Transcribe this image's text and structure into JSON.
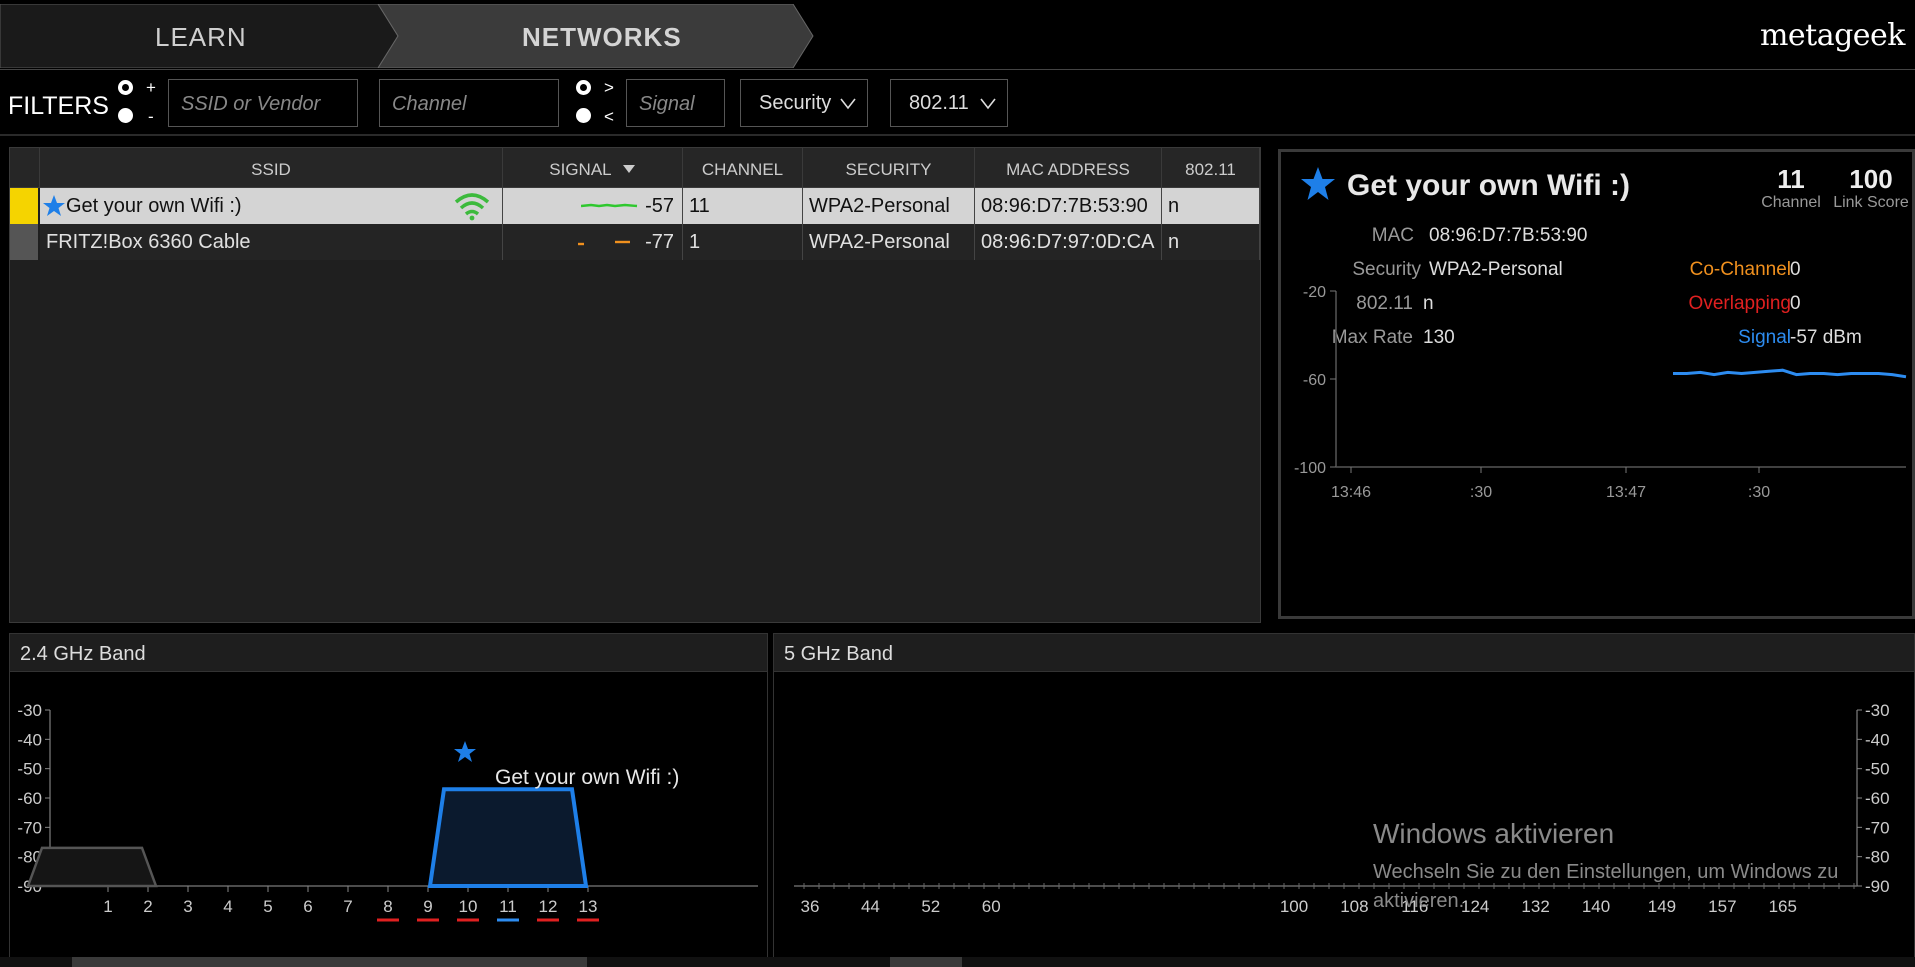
{
  "nav": {
    "learn": "LEARN",
    "networks": "NETWORKS",
    "brand": "metageek"
  },
  "filters": {
    "label": "FILTERS",
    "plus": "+",
    "minus": "-",
    "ssid_placeholder": "SSID or Vendor",
    "channel_placeholder": "Channel",
    "gt": ">",
    "lt": "<",
    "signal_placeholder": "Signal",
    "security": "Security",
    "standard": "802.11"
  },
  "table": {
    "columns": [
      "SSID",
      "SIGNAL",
      "CHANNEL",
      "SECURITY",
      "MAC ADDRESS",
      "802.11"
    ],
    "rows": [
      {
        "ssid": "Get your own Wifi :)",
        "signal": "-57",
        "channel": "11",
        "security": "WPA2-Personal",
        "mac": "08:96:D7:7B:53:90",
        "std": "n",
        "color": "#f5d400",
        "starred": true
      },
      {
        "ssid": "FRITZ!Box 6360 Cable",
        "signal": "-77",
        "channel": "1",
        "security": "WPA2-Personal",
        "mac": "08:96:D7:97:0D:CA",
        "std": "n",
        "color": "#555555",
        "starred": false
      }
    ]
  },
  "detail": {
    "title": "Get your own Wifi :)",
    "channel_value": "11",
    "channel_caption": "Channel",
    "score_value": "100",
    "score_caption": "Link Score",
    "mac_key": "MAC",
    "mac_val": "08:96:D7:7B:53:90",
    "security_key": "Security",
    "security_val": "WPA2-Personal",
    "std_key": "802.11",
    "std_val": "n",
    "rate_key": "Max Rate",
    "rate_val": "130",
    "cochannel_key": "Co-Channel",
    "cochannel_val": "0",
    "overlap_key": "Overlapping",
    "overlap_val": "0",
    "signal_key": "Signal",
    "signal_val": "-57 dBm",
    "colors": {
      "cochannel": "#f0901e",
      "overlap": "#e02020",
      "signal": "#2d8cf0"
    }
  },
  "bands": {
    "band24_title": "2.4 GHz Band",
    "band5_title": "5 GHz Band",
    "network_label": "Get your own Wifi :)"
  },
  "watermark": {
    "title": "Windows aktivieren",
    "sub": "Wechseln Sie zu den Einstellungen, um Windows zu aktivieren."
  },
  "chart_data": [
    {
      "type": "line",
      "title": "",
      "ylabel": "",
      "xlabel": "",
      "y_ticks": [
        "-20",
        "-60",
        "-100"
      ],
      "x_ticks": [
        "13:46",
        ":30",
        "13:47",
        ":30"
      ],
      "ylim": [
        -100,
        -20
      ],
      "series": [
        {
          "values": [
            -57.5,
            -57.5,
            -57,
            -58,
            -57,
            -57.5,
            -57,
            -56.5,
            -56,
            -58,
            -57.5,
            -57.5,
            -58,
            -57.5,
            -57.5,
            -57.5,
            -58,
            -59
          ]
        }
      ]
    },
    {
      "type": "area",
      "title": "2.4 GHz Band",
      "y_ticks": [
        "-30",
        "-40",
        "-50",
        "-60",
        "-70",
        "-80",
        "-90"
      ],
      "x_ticks": [
        "1",
        "2",
        "3",
        "4",
        "5",
        "6",
        "7",
        "8",
        "9",
        "10",
        "11",
        "12",
        "13"
      ],
      "ylim": [
        -90,
        -30
      ],
      "series": [
        {
          "name": "Get your own Wifi :)",
          "channel": 11,
          "value": -57
        },
        {
          "channel": 1,
          "value": -77
        }
      ]
    },
    {
      "type": "area",
      "title": "5 GHz Band",
      "y_ticks": [
        "-30",
        "-40",
        "-50",
        "-60",
        "-70",
        "-80",
        "-90"
      ],
      "x_ticks": [
        "36",
        "44",
        "52",
        "60",
        "100",
        "108",
        "116",
        "124",
        "132",
        "140",
        "149",
        "157",
        "165"
      ],
      "ylim": [
        -90,
        -30
      ],
      "series": []
    }
  ]
}
